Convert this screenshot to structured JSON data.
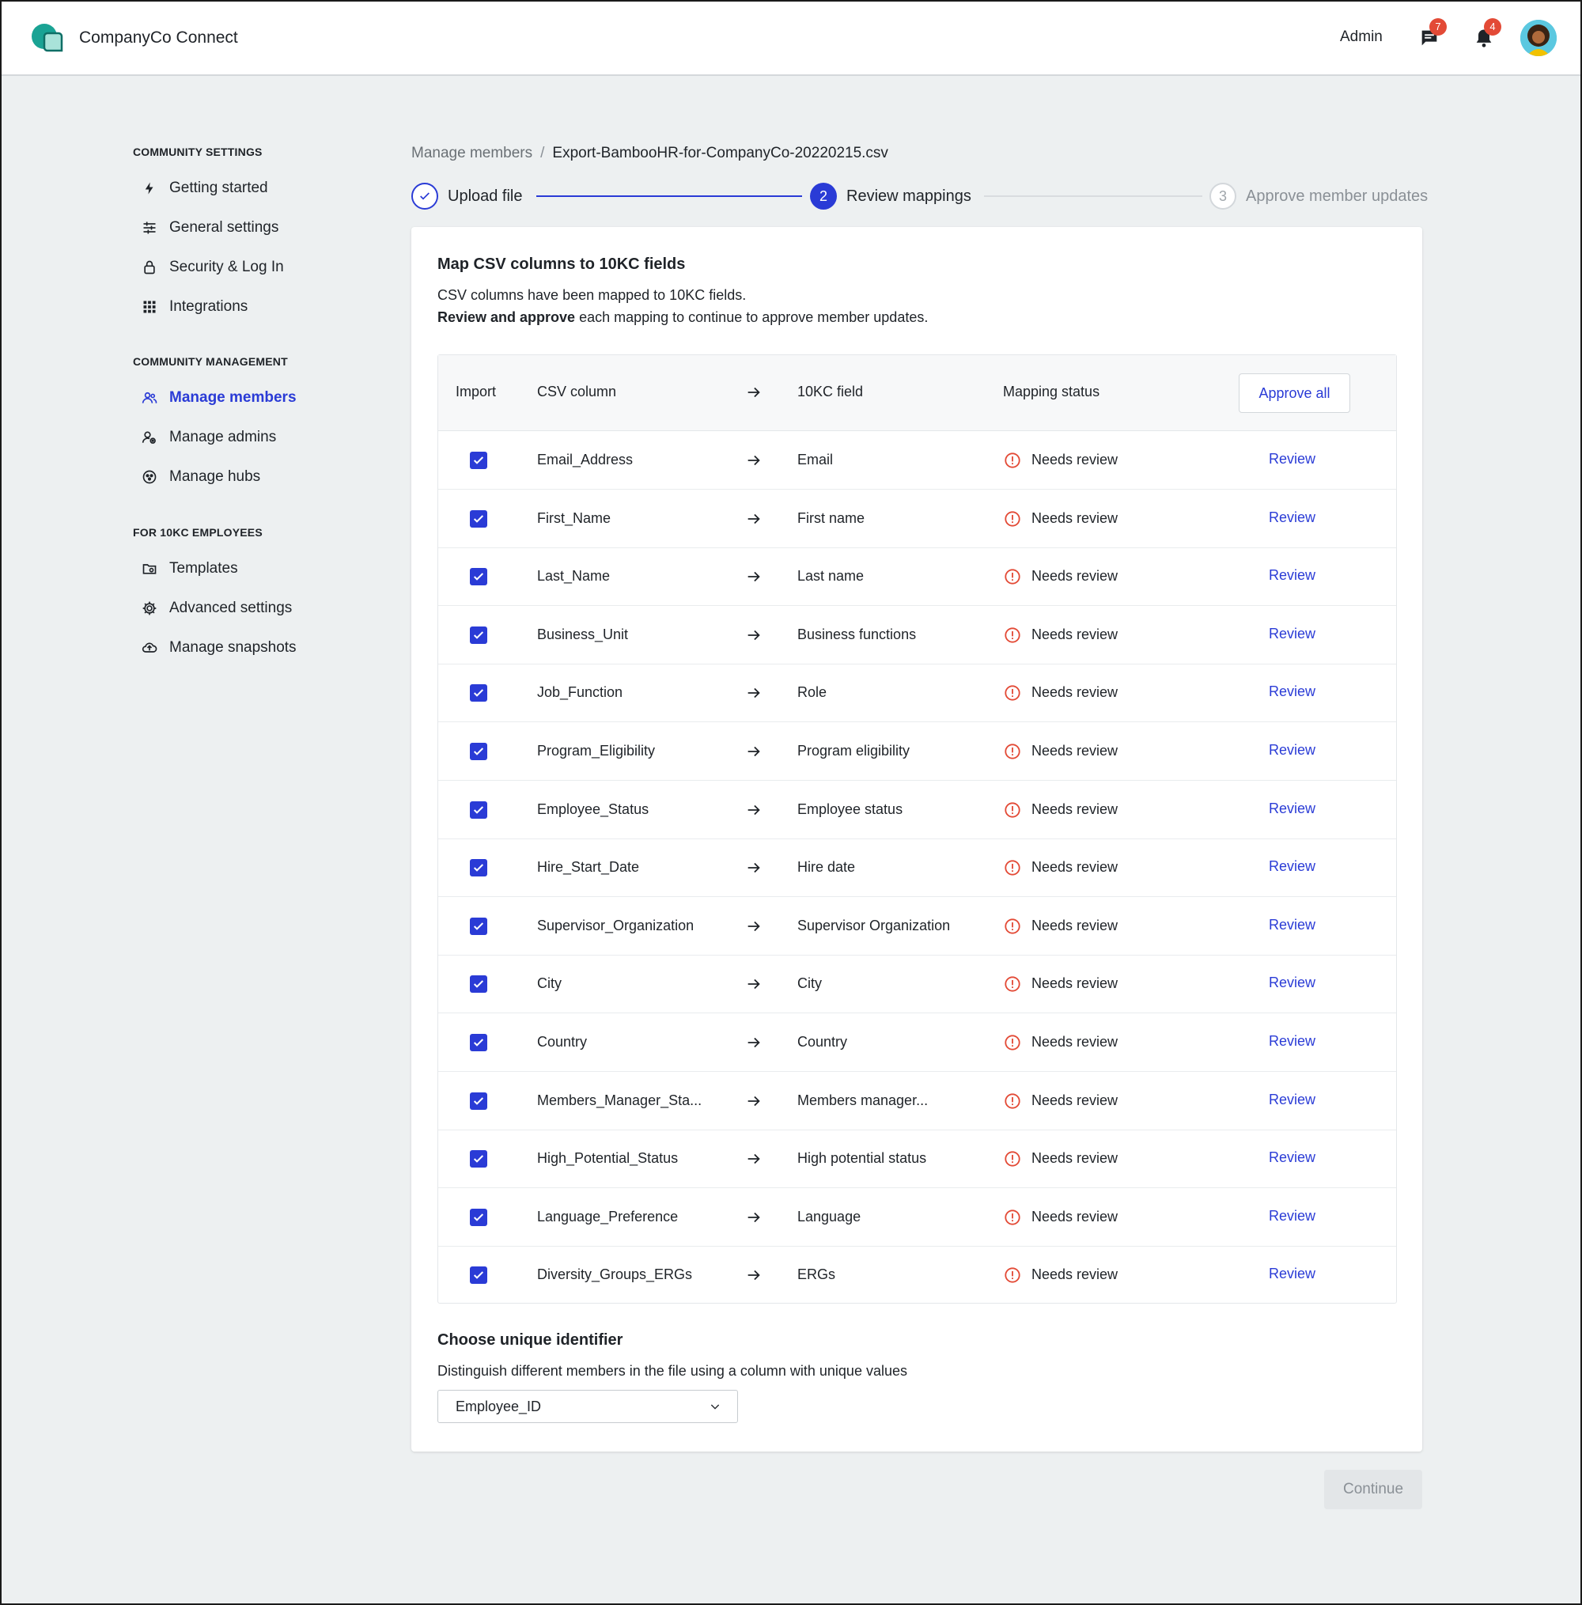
{
  "header": {
    "app_title": "CompanyCo Connect",
    "admin_label": "Admin",
    "messages_count": "7",
    "notifications_count": "4"
  },
  "sidebar": {
    "sections": [
      {
        "title": "COMMUNITY SETTINGS",
        "items": [
          {
            "label": "Getting started",
            "icon": "lightning-icon"
          },
          {
            "label": "General settings",
            "icon": "sliders-icon"
          },
          {
            "label": "Security & Log In",
            "icon": "lock-icon"
          },
          {
            "label": "Integrations",
            "icon": "grid-icon"
          }
        ]
      },
      {
        "title": "COMMUNITY MANAGEMENT",
        "items": [
          {
            "label": "Manage members",
            "icon": "users-icon",
            "active": true
          },
          {
            "label": "Manage admins",
            "icon": "admin-icon"
          },
          {
            "label": "Manage hubs",
            "icon": "hubs-icon"
          }
        ]
      },
      {
        "title": "FOR 10KC EMPLOYEES",
        "items": [
          {
            "label": "Templates",
            "icon": "folder-icon"
          },
          {
            "label": "Advanced settings",
            "icon": "gear-icon"
          },
          {
            "label": "Manage snapshots",
            "icon": "cloud-upload-icon"
          }
        ]
      }
    ]
  },
  "breadcrumb": {
    "parent": "Manage members",
    "separator": "/",
    "current": "Export-BambooHR-for-CompanyCo-20220215.csv"
  },
  "stepper": {
    "steps": [
      {
        "label": "Upload file",
        "state": "done"
      },
      {
        "number": "2",
        "label": "Review mappings",
        "state": "active"
      },
      {
        "number": "3",
        "label": "Approve member updates",
        "state": "pending"
      }
    ]
  },
  "card": {
    "title": "Map CSV columns to 10KC fields",
    "desc_line1": "CSV columns have been mapped to 10KC fields.",
    "desc_bold": "Review and approve",
    "desc_rest": " each mapping to continue to approve member updates."
  },
  "table": {
    "headers": {
      "import": "Import",
      "csv_column": "CSV column",
      "field": "10KC field",
      "status": "Mapping status"
    },
    "approve_all_label": "Approve all",
    "status_text": "Needs review",
    "review_label": "Review",
    "rows": [
      {
        "csv": "Email_Address",
        "field": "Email"
      },
      {
        "csv": "First_Name",
        "field": "First name"
      },
      {
        "csv": "Last_Name",
        "field": "Last name"
      },
      {
        "csv": "Business_Unit",
        "field": "Business functions"
      },
      {
        "csv": "Job_Function",
        "field": "Role"
      },
      {
        "csv": "Program_Eligibility",
        "field": "Program eligibility"
      },
      {
        "csv": "Employee_Status",
        "field": "Employee status"
      },
      {
        "csv": "Hire_Start_Date",
        "field": "Hire date"
      },
      {
        "csv": "Supervisor_Organization",
        "field": "Supervisor Organization"
      },
      {
        "csv": "City",
        "field": "City"
      },
      {
        "csv": "Country",
        "field": "Country"
      },
      {
        "csv": "Members_Manager_Sta...",
        "field": "Members manager..."
      },
      {
        "csv": "High_Potential_Status",
        "field": "High potential status"
      },
      {
        "csv": "Language_Preference",
        "field": "Language"
      },
      {
        "csv": "Diversity_Groups_ERGs",
        "field": "ERGs"
      }
    ]
  },
  "unique_identifier": {
    "title": "Choose unique identifier",
    "description": "Distinguish different members in the file using a column with unique values",
    "selected": "Employee_ID"
  },
  "continue_label": "Continue",
  "colors": {
    "accent": "#2a3bd6",
    "warning": "#e34a36",
    "brand": "#1aa394"
  }
}
